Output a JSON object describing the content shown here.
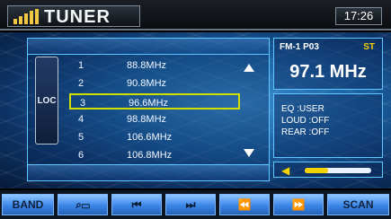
{
  "header": {
    "title": "TUNER",
    "time": "17:26"
  },
  "list": {
    "loc_label": "LOC",
    "presets": [
      {
        "num": "1",
        "freq": "88.8MHz"
      },
      {
        "num": "2",
        "freq": "90.8MHz"
      },
      {
        "num": "3",
        "freq": "96.6MHz"
      },
      {
        "num": "4",
        "freq": "98.8MHz"
      },
      {
        "num": "5",
        "freq": "106.6MHz"
      },
      {
        "num": "6",
        "freq": "106.8MHz"
      }
    ],
    "selected_index": 3
  },
  "info": {
    "band_preset": "FM-1  P03",
    "stereo": "ST",
    "frequency": "97.1 MHz"
  },
  "audio": {
    "eq": "EQ    :USER",
    "loud": "LOUD :OFF",
    "rear": "REAR :OFF"
  },
  "volume": {
    "level": 0.35,
    "icon": "speaker-icon"
  },
  "buttons": {
    "band": "BAND",
    "search_icon": "search-list-icon",
    "prev_track_icon": "skip-back-icon",
    "next_track_icon": "skip-forward-icon",
    "seek_back_icon": "rewind-icon",
    "seek_forward_icon": "fast-forward-icon",
    "scan": "SCAN"
  },
  "colors": {
    "accent_blue": "#5ec7ff",
    "highlight_yellow": "#d1e000"
  }
}
